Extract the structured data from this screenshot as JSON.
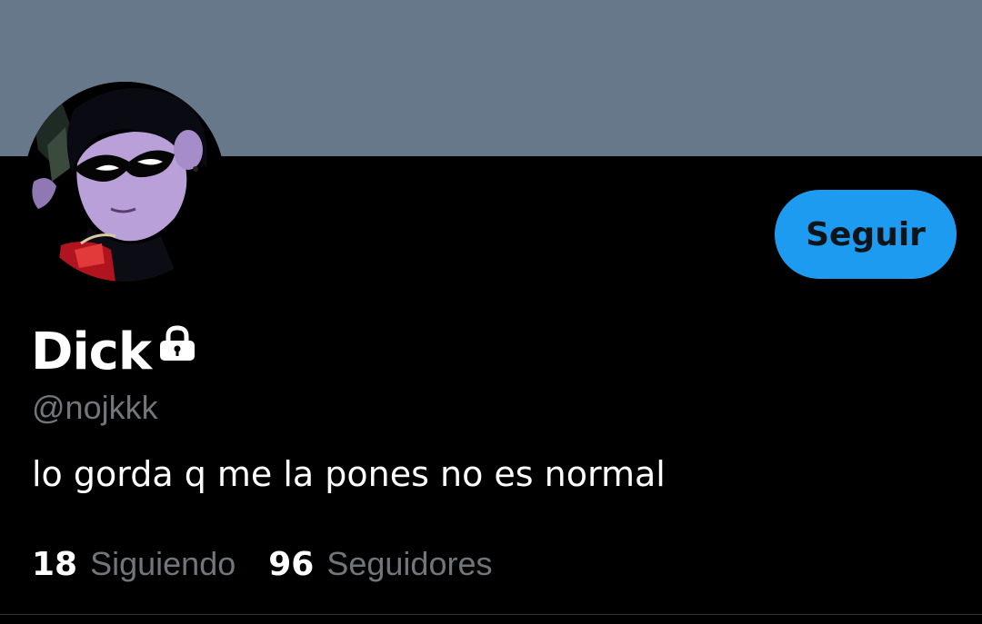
{
  "profile": {
    "display_name": "Dick",
    "handle": "@nojkkk",
    "bio": "lo gorda q me la pones no es normal",
    "protected": true,
    "lock_icon": "lock-icon",
    "avatar": "avatar-image"
  },
  "actions": {
    "follow_label": "Seguir"
  },
  "stats": {
    "following_count": "18",
    "following_label": "Siguiendo",
    "followers_count": "96",
    "followers_label": "Seguidores"
  },
  "colors": {
    "banner": "#66788a",
    "background": "#000000",
    "accent": "#1d9bf0",
    "secondary_text": "#71767b"
  }
}
